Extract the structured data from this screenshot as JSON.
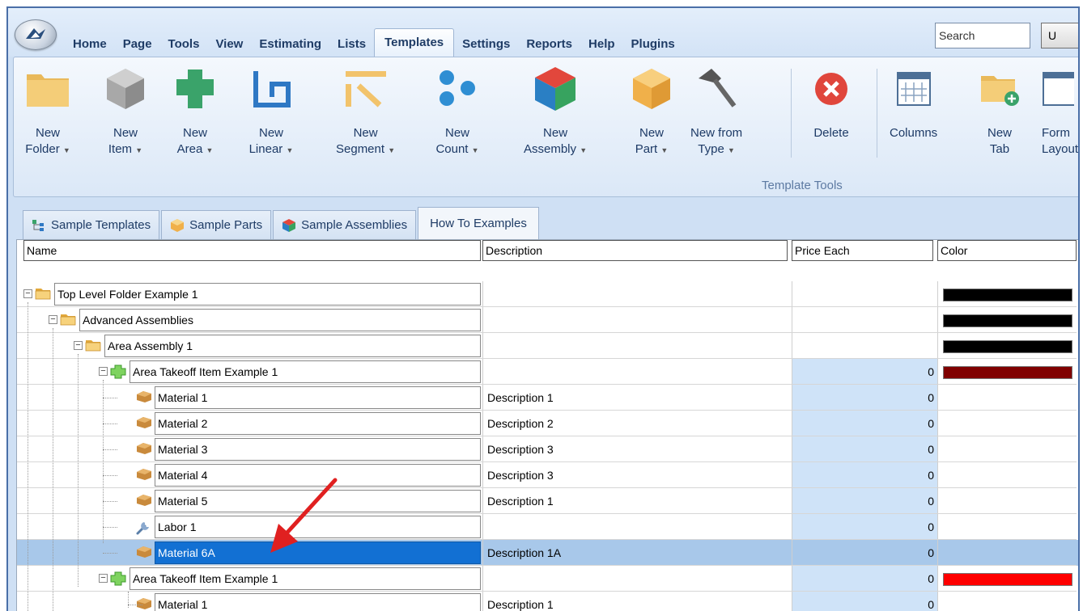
{
  "tabs": [
    "Home",
    "Page",
    "Tools",
    "View",
    "Estimating",
    "Lists",
    "Templates",
    "Settings",
    "Reports",
    "Help",
    "Plugins"
  ],
  "active_tab": "Templates",
  "search": {
    "value": "Search",
    "button_label": "U"
  },
  "ribbon": {
    "buttons": [
      {
        "line1": "New",
        "line2": "Folder"
      },
      {
        "line1": "New",
        "line2": "Item"
      },
      {
        "line1": "New",
        "line2": "Area"
      },
      {
        "line1": "New",
        "line2": "Linear"
      },
      {
        "line1": "New",
        "line2": "Segment"
      },
      {
        "line1": "New",
        "line2": "Count"
      },
      {
        "line1": "New",
        "line2": "Assembly"
      },
      {
        "line1": "New",
        "line2": "Part"
      },
      {
        "line1": "New from",
        "line2": "Type"
      },
      {
        "line1": "Delete",
        "line2": ""
      },
      {
        "line1": "Columns",
        "line2": ""
      },
      {
        "line1": "New",
        "line2": "Tab"
      },
      {
        "line1": "Form",
        "line2": "Layout"
      }
    ],
    "group_label": "Template Tools"
  },
  "doc_tabs": [
    "Sample Templates",
    "Sample Parts",
    "Sample Assemblies",
    "How To Examples"
  ],
  "columns": {
    "name": "Name",
    "description": "Description",
    "price": "Price Each",
    "color": "Color"
  },
  "rows": [
    {
      "name": "Top Level Folder Example 1",
      "description": "",
      "price": "",
      "color": "#000000"
    },
    {
      "name": "Advanced Assemblies",
      "description": "",
      "price": "",
      "color": "#000000"
    },
    {
      "name": "Area Assembly 1",
      "description": "",
      "price": "",
      "color": "#000000"
    },
    {
      "name": "Area Takeoff Item Example 1",
      "description": "",
      "price": "0",
      "color": "#800000"
    },
    {
      "name": "Material 1",
      "description": "Description 1",
      "price": "0",
      "color": ""
    },
    {
      "name": "Material 2",
      "description": "Description 2",
      "price": "0",
      "color": ""
    },
    {
      "name": "Material 3",
      "description": "Description 3",
      "price": "0",
      "color": ""
    },
    {
      "name": "Material 4",
      "description": "Description 3",
      "price": "0",
      "color": ""
    },
    {
      "name": "Material 5",
      "description": "Description 1",
      "price": "0",
      "color": ""
    },
    {
      "name": "Labor 1",
      "description": "",
      "price": "0",
      "color": ""
    },
    {
      "name": "Material 6A",
      "description": "Description 1A",
      "price": "0",
      "color": ""
    },
    {
      "name": "Area Takeoff Item Example 1",
      "description": "",
      "price": "0",
      "color": "#ff0000"
    },
    {
      "name": "Material 1",
      "description": "Description 1",
      "price": "0",
      "color": ""
    }
  ],
  "colors": {
    "accent": "#1270d3",
    "selected_row": "#a8c8ea",
    "arrow": "#e02020"
  }
}
